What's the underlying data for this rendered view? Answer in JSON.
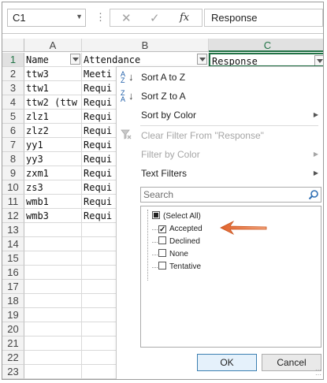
{
  "formula_bar": {
    "name_box": "C1",
    "more_icon": "⋮",
    "cancel_icon": "✕",
    "enter_icon": "✓",
    "fx_icon": "fx",
    "value": "Response"
  },
  "columns": [
    "A",
    "B",
    "C"
  ],
  "rows": [
    {
      "num": "1",
      "a": "Name",
      "b": "Attendance",
      "c": "Response"
    },
    {
      "num": "2",
      "a": "ttw3",
      "b": "Meeti",
      "c": ""
    },
    {
      "num": "3",
      "a": "ttw1",
      "b": "Requi",
      "c": ""
    },
    {
      "num": "4",
      "a": "ttw2 (ttw",
      "b": "Requi",
      "c": ""
    },
    {
      "num": "5",
      "a": "zlz1",
      "b": "Requi",
      "c": ""
    },
    {
      "num": "6",
      "a": "zlz2",
      "b": "Requi",
      "c": ""
    },
    {
      "num": "7",
      "a": "yy1",
      "b": "Requi",
      "c": ""
    },
    {
      "num": "8",
      "a": "yy3",
      "b": "Requi",
      "c": ""
    },
    {
      "num": "9",
      "a": "zxm1",
      "b": "Requi",
      "c": ""
    },
    {
      "num": "10",
      "a": "zs3",
      "b": "Requi",
      "c": ""
    },
    {
      "num": "11",
      "a": "wmb1",
      "b": "Requi",
      "c": ""
    },
    {
      "num": "12",
      "a": "wmb3",
      "b": "Requi",
      "c": ""
    },
    {
      "num": "13",
      "a": "",
      "b": "",
      "c": ""
    },
    {
      "num": "14",
      "a": "",
      "b": "",
      "c": ""
    },
    {
      "num": "15",
      "a": "",
      "b": "",
      "c": ""
    },
    {
      "num": "16",
      "a": "",
      "b": "",
      "c": ""
    },
    {
      "num": "17",
      "a": "",
      "b": "",
      "c": ""
    },
    {
      "num": "18",
      "a": "",
      "b": "",
      "c": ""
    },
    {
      "num": "19",
      "a": "",
      "b": "",
      "c": ""
    },
    {
      "num": "20",
      "a": "",
      "b": "",
      "c": ""
    },
    {
      "num": "21",
      "a": "",
      "b": "",
      "c": ""
    },
    {
      "num": "22",
      "a": "",
      "b": "",
      "c": ""
    },
    {
      "num": "23",
      "a": "",
      "b": "",
      "c": ""
    }
  ],
  "menu": {
    "sort_az": "Sort A to Z",
    "sort_za": "Sort Z to A",
    "sort_color": "Sort by Color",
    "clear_filter": "Clear Filter From \"Response\"",
    "filter_color": "Filter by Color",
    "text_filters": "Text Filters",
    "search_placeholder": "Search",
    "items": [
      {
        "label": "(Select All)",
        "state": "partial"
      },
      {
        "label": "Accepted",
        "state": "checked"
      },
      {
        "label": "Declined",
        "state": "unchecked"
      },
      {
        "label": "None",
        "state": "unchecked"
      },
      {
        "label": "Tentative",
        "state": "unchecked"
      }
    ],
    "ok": "OK",
    "cancel": "Cancel"
  },
  "colors": {
    "accent": "#217346",
    "arrow": "#e0622b"
  }
}
